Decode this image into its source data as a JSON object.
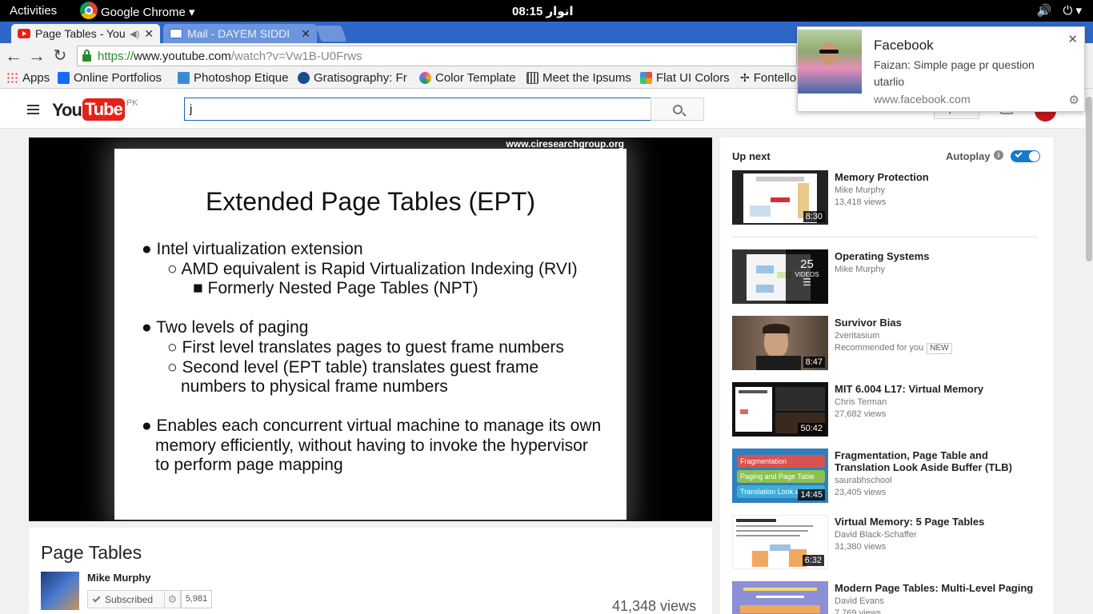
{
  "os_bar": {
    "activities": "Activities",
    "app_name": "Google Chrome ▾",
    "clock": "انوار 08:15",
    "volume_icon": "🔊",
    "power_icon": "⏻ ▾"
  },
  "tabs": [
    {
      "label": "Page Tables - You"
    },
    {
      "label": "Mail - DAYEM SIDDI"
    }
  ],
  "toolbar": {
    "url_scheme": "https://",
    "url_host": "www.youtube.com",
    "url_path": "/watch?v=Vw1B-U0Frws"
  },
  "bookmarks": [
    {
      "label": "Apps",
      "color": "#e0442a"
    },
    {
      "label": "Online Portfolios",
      "color": "#1769ff"
    },
    {
      "label": "Photoshop Etique",
      "color": "#3a8bd6"
    },
    {
      "label": "Gratisography: Fr",
      "color": "#1a4d8c"
    },
    {
      "label": "Color Template",
      "color": "#e84aa6"
    },
    {
      "label": "Meet the Ipsums",
      "color": "#555555"
    },
    {
      "label": "Flat UI Colors",
      "color": "#f39c12"
    },
    {
      "label": "Fontello",
      "color": "#333333"
    }
  ],
  "youtube": {
    "logo_you": "You",
    "logo_tube": "Tube",
    "logo_region": "PK",
    "search_value": "j",
    "upload_label": "Upload"
  },
  "slide": {
    "watermark": "www.ciresearchgroup.org",
    "title": "Extended Page Tables (EPT)",
    "lines": [
      "● Intel virtualization extension",
      "○ AMD equivalent is Rapid Virtualization Indexing (RVI)",
      "■ Formerly Nested Page Tables (NPT)",
      "● Two levels of paging",
      "○ First level translates pages to guest frame numbers",
      "○ Second level (EPT table) translates guest frame",
      "numbers to physical frame numbers",
      "● Enables each concurrent virtual machine to manage its own",
      "memory efficiently, without having to invoke the hypervisor",
      "to perform page mapping"
    ]
  },
  "video_info": {
    "title": "Page Tables",
    "channel": "Mike Murphy",
    "subscribed_label": "Subscribed",
    "subscriber_count": "5,981",
    "views": "41,348 views"
  },
  "sidebar": {
    "up_next_label": "Up next",
    "autoplay_label": "Autoplay",
    "recommendations": [
      {
        "title": "Memory Protection",
        "channel": "Mike Murphy",
        "views": "13,418 views",
        "duration": "8:30"
      },
      {
        "title": "Operating Systems",
        "channel": "Mike Murphy",
        "playlist_count": "25",
        "playlist_label": "VIDEOS"
      },
      {
        "title": "Survivor Bias",
        "channel": "2veritasium",
        "extra": "Recommended for you",
        "badge": "NEW",
        "duration": "8:47"
      },
      {
        "title": "MIT 6.004 L17: Virtual Memory",
        "channel": "Chris Terman",
        "views": "27,682 views",
        "duration": "50:42"
      },
      {
        "title": "Fragmentation, Page Table and Translation Look Aside Buffer (TLB)",
        "channel": "saurabhschool",
        "views": "23,405 views",
        "duration": "14:45",
        "thumb_labels": [
          "Fragmentation",
          "Paging and Page Table",
          "Translation Look aside"
        ]
      },
      {
        "title": "Virtual Memory: 5 Page Tables",
        "channel": "David Black-Schaffer",
        "views": "31,380 views",
        "duration": "6:32"
      },
      {
        "title": "Modern Page Tables: Multi-Level Paging",
        "channel": "David Evans",
        "views": "7,769 views"
      }
    ]
  },
  "notification": {
    "title": "Facebook",
    "body": "Faizan: Simple page pr question utarlio",
    "source": "www.facebook.com"
  }
}
